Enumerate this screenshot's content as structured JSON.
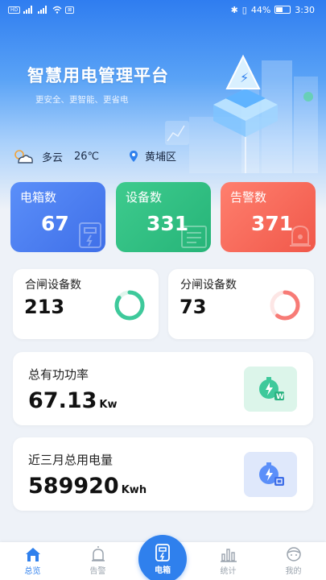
{
  "status_bar": {
    "time": "3:30",
    "battery": "44%"
  },
  "header": {
    "title": "智慧用电管理平台",
    "subtitle": "更安全、更智能、更省电"
  },
  "weather": {
    "condition": "多云",
    "temperature": "26℃",
    "location": "黄埔区",
    "icon": "cloud-sun-icon"
  },
  "stats": [
    {
      "label": "电箱数",
      "value": "67",
      "color": "#4f7ff3"
    },
    {
      "label": "设备数",
      "value": "331",
      "color": "#32c184"
    },
    {
      "label": "告警数",
      "value": "371",
      "color": "#f86d5d"
    }
  ],
  "switch_cards": [
    {
      "label": "合闸设备数",
      "value": "213",
      "ring_color": "#3ec99b",
      "ring_fraction": 0.85
    },
    {
      "label": "分闸设备数",
      "value": "73",
      "ring_color": "#f77b76",
      "ring_fraction": 0.6
    }
  ],
  "power": {
    "label": "总有功功率",
    "value": "67.13",
    "unit": "Kw",
    "icon": "power-meter-icon"
  },
  "energy": {
    "label": "近三月总用电量",
    "value": "589920",
    "unit": "Kwh",
    "icon": "energy-meter-icon"
  },
  "tabs": [
    {
      "label": "总览",
      "icon": "home-icon",
      "active": true
    },
    {
      "label": "告警",
      "icon": "alarm-icon",
      "active": false
    },
    {
      "label": "电箱",
      "icon": "electric-box-icon",
      "active": false
    },
    {
      "label": "统计",
      "icon": "bar-chart-icon",
      "active": false
    },
    {
      "label": "我的",
      "icon": "profile-icon",
      "active": false
    }
  ]
}
